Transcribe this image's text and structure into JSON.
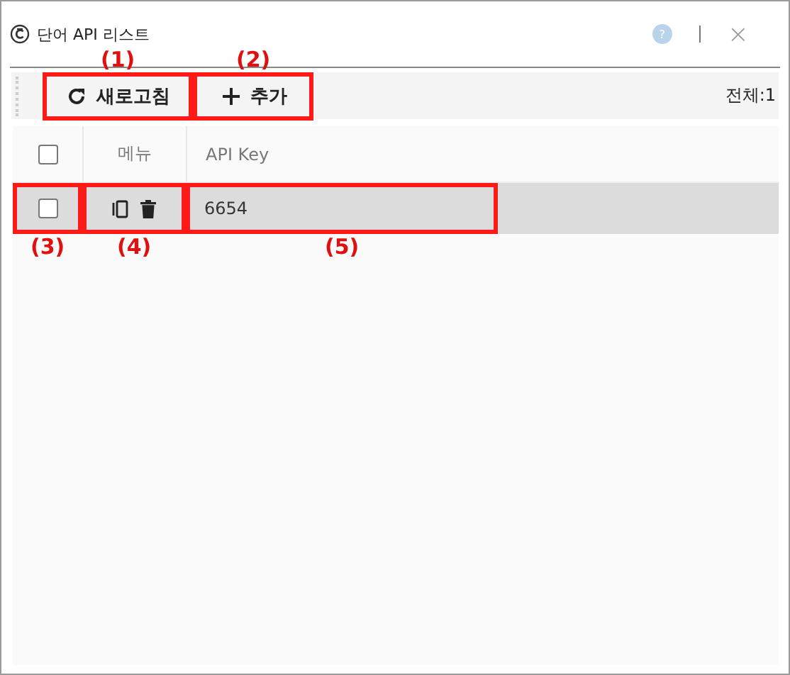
{
  "window": {
    "title": "단어 API 리스트",
    "help": "?",
    "close": "×"
  },
  "toolbar": {
    "buttons": [
      {
        "kind": "refresh",
        "label": "새로고침",
        "callout": "(1)"
      },
      {
        "kind": "add",
        "label": "추가",
        "callout": "(2)"
      }
    ],
    "total": "전체:1"
  },
  "table": {
    "header_checked": false,
    "columns": [
      "메뉴",
      "API Key"
    ],
    "rows": [
      {
        "checked": false,
        "selected": true,
        "key": "6654",
        "callouts": [
          "(3)",
          "(4)",
          "(5)"
        ]
      }
    ]
  }
}
